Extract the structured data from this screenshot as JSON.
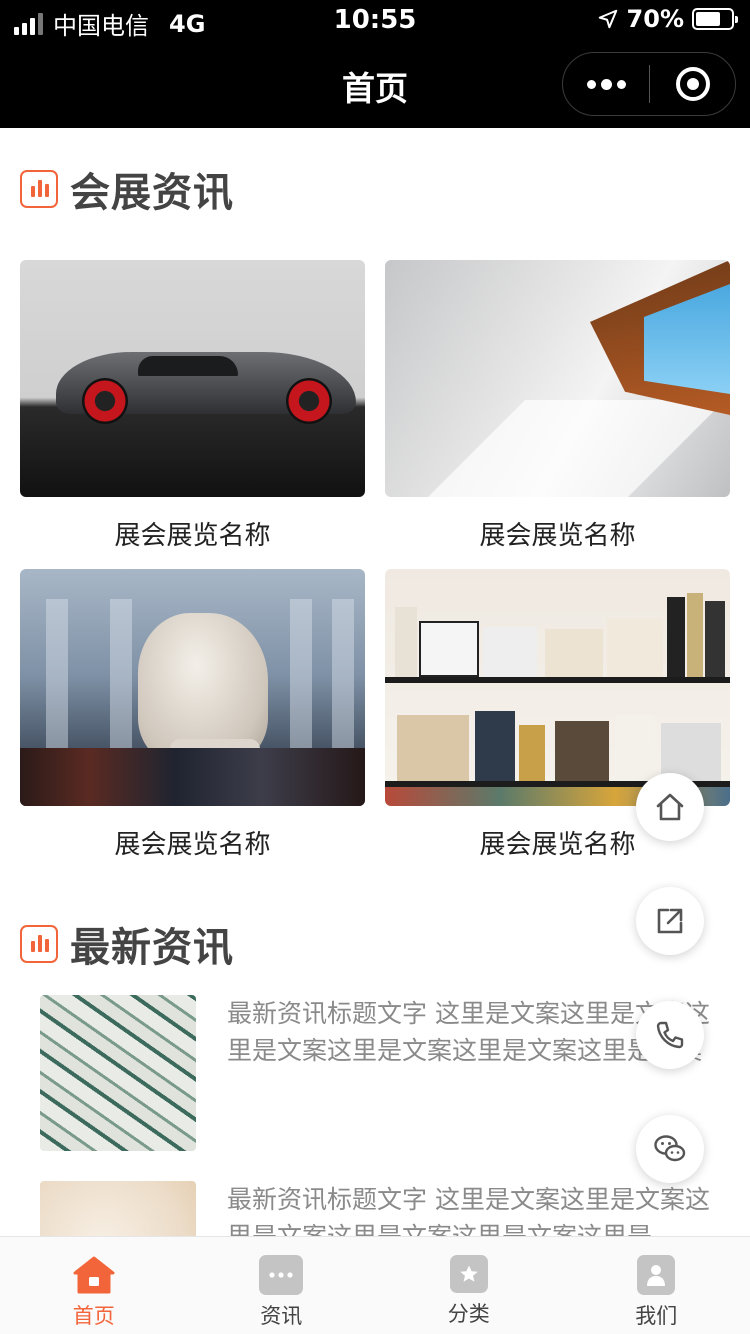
{
  "status_bar": {
    "carrier": "中国电信",
    "network": "4G",
    "time": "10:55",
    "battery": "70%",
    "battery_level": 0.7,
    "signal_icon": "signal-bars-icon",
    "location_icon": "location-arrow-icon"
  },
  "nav": {
    "title": "首页",
    "more_icon": "more-dots-icon",
    "close_icon": "target-circle-icon"
  },
  "expo_section": {
    "title": "会展资讯",
    "items": [
      {
        "name": "展会展览名称",
        "image": "sports-car"
      },
      {
        "name": "展会展览名称",
        "image": "sunlit-room-window"
      },
      {
        "name": "展会展览名称",
        "image": "statue-bust-museum"
      },
      {
        "name": "展会展览名称",
        "image": "bookshelf"
      }
    ]
  },
  "news_section": {
    "title": "最新资讯",
    "items": [
      {
        "text": "最新资讯标题文字 这里是文案这里是文案这里是文案这里是文案这里是文案这里是文案",
        "image": "leaf-pattern"
      },
      {
        "text": "最新资讯标题文字 这里是文案这里是文案这里是文案这里是文案这里是文案这里是",
        "image": "sketch-drawing"
      }
    ]
  },
  "floating_actions": [
    "home-icon",
    "share-icon",
    "phone-icon",
    "wechat-icon"
  ],
  "tab_bar": {
    "active_color": "#f2653a",
    "tabs": [
      {
        "label": "首页",
        "icon": "home-icon",
        "active": true
      },
      {
        "label": "资讯",
        "icon": "chat-bubble-icon",
        "active": false
      },
      {
        "label": "分类",
        "icon": "star-icon",
        "active": false
      },
      {
        "label": "我们",
        "icon": "user-icon",
        "active": false
      }
    ]
  },
  "colors": {
    "accent": "#f2653a",
    "header_bg": "#000000"
  }
}
